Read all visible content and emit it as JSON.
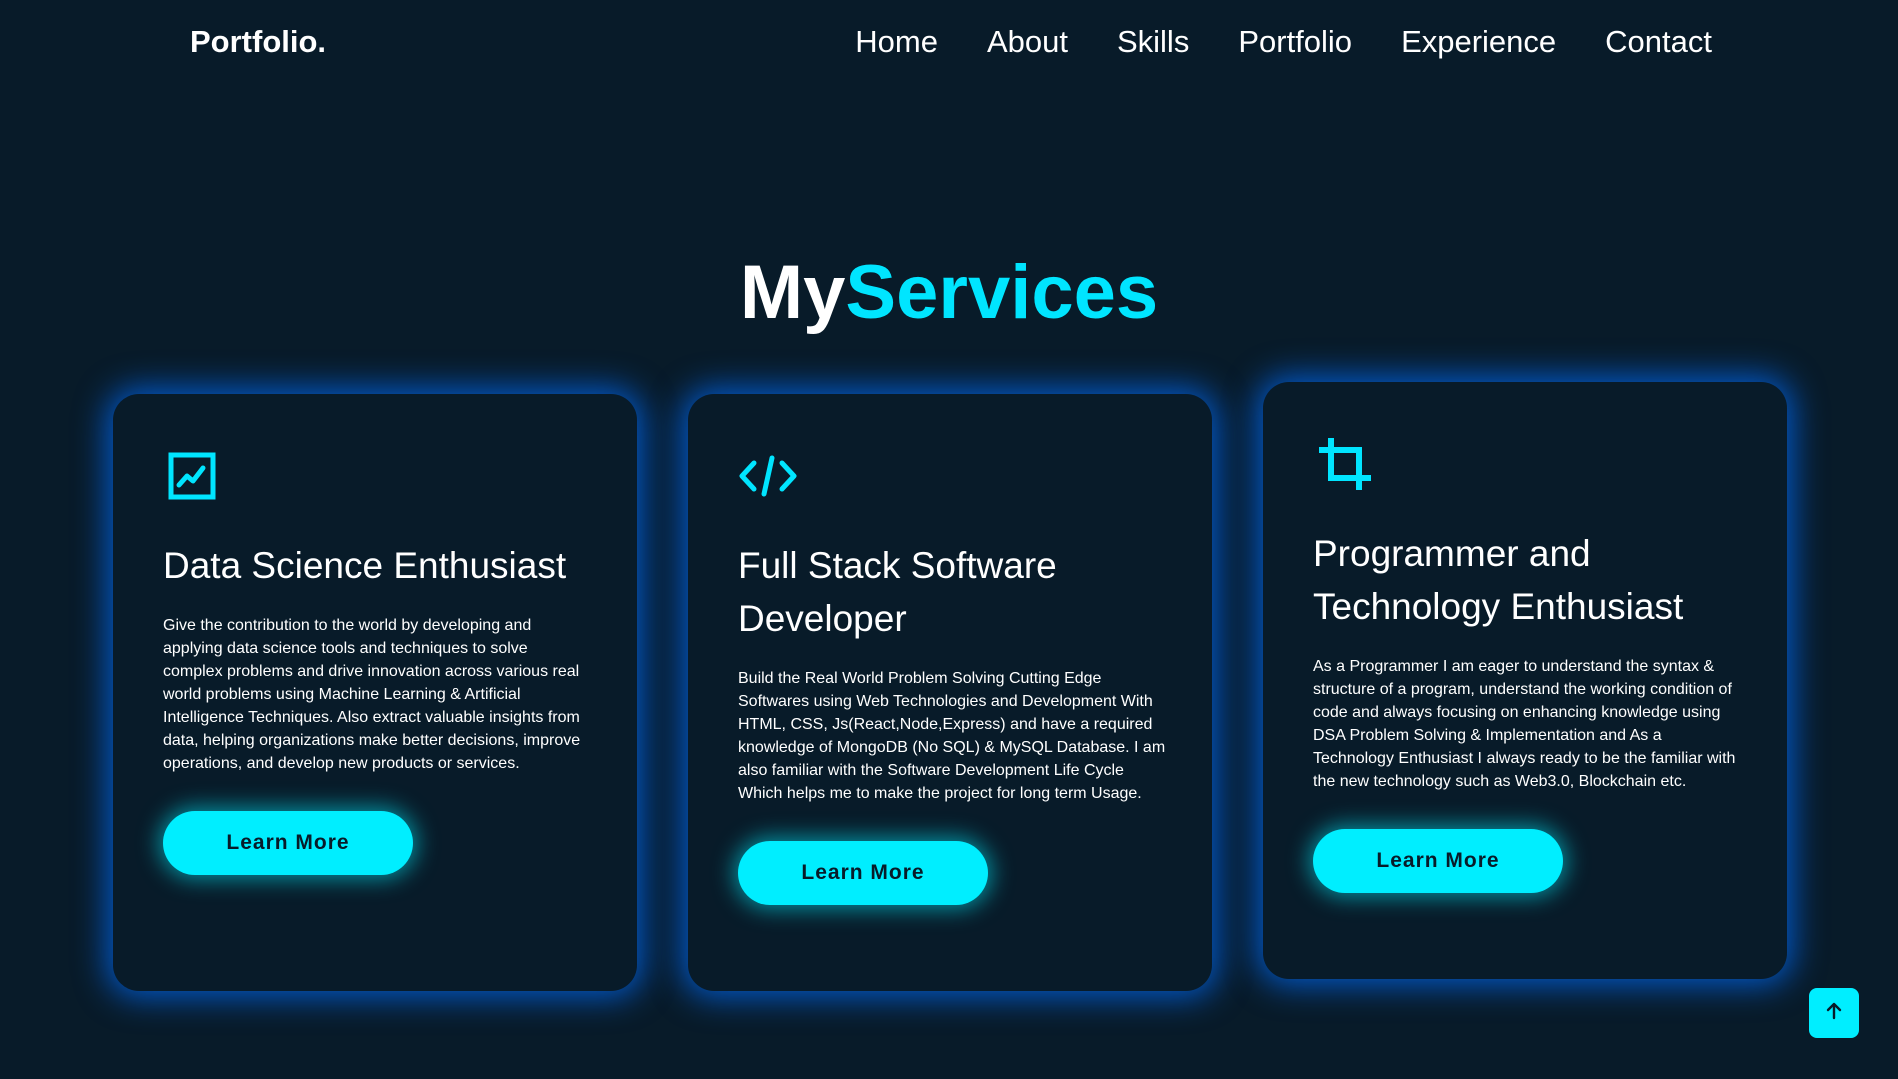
{
  "header": {
    "logo": "Portfolio.",
    "nav": [
      "Home",
      "About",
      "Skills",
      "Portfolio",
      "Experience",
      "Contact"
    ]
  },
  "section": {
    "title_part1": "My",
    "title_part2": "Services"
  },
  "services": [
    {
      "icon": "chart-icon",
      "title": "Data Science Enthusiast",
      "description": "Give the contribution to the world by developing and applying data science tools and techniques to solve complex problems and drive innovation across various real world problems using Machine Learning & Artificial Intelligence Techniques. Also extract valuable insights from data, helping organizations make better decisions, improve operations, and develop new products or services.",
      "button": "Learn More"
    },
    {
      "icon": "code-icon",
      "title": "Full Stack Software Developer",
      "description": "Build the Real World Problem Solving Cutting Edge Softwares using Web Technologies and Development With HTML, CSS, Js(React,Node,Express) and have a required knowledge of MongoDB (No SQL) & MySQL Database. I am also familiar with the Software Development Life Cycle Which helps me to make the project for long term Usage.",
      "button": "Learn More"
    },
    {
      "icon": "crop-icon",
      "title": "Programmer and Technology Enthusiast",
      "description": "As a Programmer I am eager to understand the syntax & structure of a program, understand the working condition of code and always focusing on enhancing knowledge using DSA Problem Solving & Implementation and As a Technology Enthusiast I always ready to be the familiar with the new technology such as Web3.0, Blockchain etc.",
      "button": "Learn More"
    }
  ],
  "colors": {
    "background": "#081b29",
    "accent": "#00eeff",
    "glow": "#006eff"
  },
  "scroll_top_icon": "arrow-up-icon"
}
